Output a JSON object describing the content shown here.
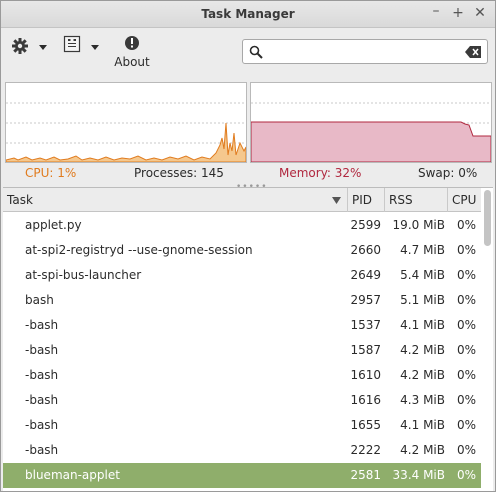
{
  "window": {
    "title": "Task Manager",
    "min": "–",
    "max": "+",
    "close": "✕"
  },
  "toolbar": {
    "settings_icon": "gear-icon",
    "view_icon": "columns-icon",
    "about_icon": "info-icon",
    "about_label": "About"
  },
  "search": {
    "value": "",
    "placeholder": ""
  },
  "status": {
    "cpu": "CPU: 1%",
    "processes": "Processes: 145",
    "memory": "Memory: 32%",
    "swap": "Swap: 0%"
  },
  "colors": {
    "cpu": "#e07b1e",
    "memory": "#b0283f",
    "memory_fill": "#e8b9c7",
    "selected_row": "#8fae6b"
  },
  "table": {
    "headers": {
      "task": "Task",
      "pid": "PID",
      "rss": "RSS",
      "cpu": "CPU"
    },
    "rows": [
      {
        "task": "applet.py",
        "pid": "2599",
        "rss": "19.0 MiB",
        "cpu": "0%"
      },
      {
        "task": "at-spi2-registryd --use-gnome-session",
        "pid": "2660",
        "rss": "4.7 MiB",
        "cpu": "0%"
      },
      {
        "task": "at-spi-bus-launcher",
        "pid": "2649",
        "rss": "5.4 MiB",
        "cpu": "0%"
      },
      {
        "task": "bash",
        "pid": "2957",
        "rss": "5.1 MiB",
        "cpu": "0%"
      },
      {
        "task": "-bash",
        "pid": "1537",
        "rss": "4.1 MiB",
        "cpu": "0%"
      },
      {
        "task": "-bash",
        "pid": "1587",
        "rss": "4.2 MiB",
        "cpu": "0%"
      },
      {
        "task": "-bash",
        "pid": "1610",
        "rss": "4.2 MiB",
        "cpu": "0%"
      },
      {
        "task": "-bash",
        "pid": "1616",
        "rss": "4.3 MiB",
        "cpu": "0%"
      },
      {
        "task": "-bash",
        "pid": "1655",
        "rss": "4.1 MiB",
        "cpu": "0%"
      },
      {
        "task": "-bash",
        "pid": "2222",
        "rss": "4.2 MiB",
        "cpu": "0%"
      },
      {
        "task": "blueman-applet",
        "pid": "2581",
        "rss": "33.4 MiB",
        "cpu": "0%",
        "selected": true
      }
    ]
  }
}
